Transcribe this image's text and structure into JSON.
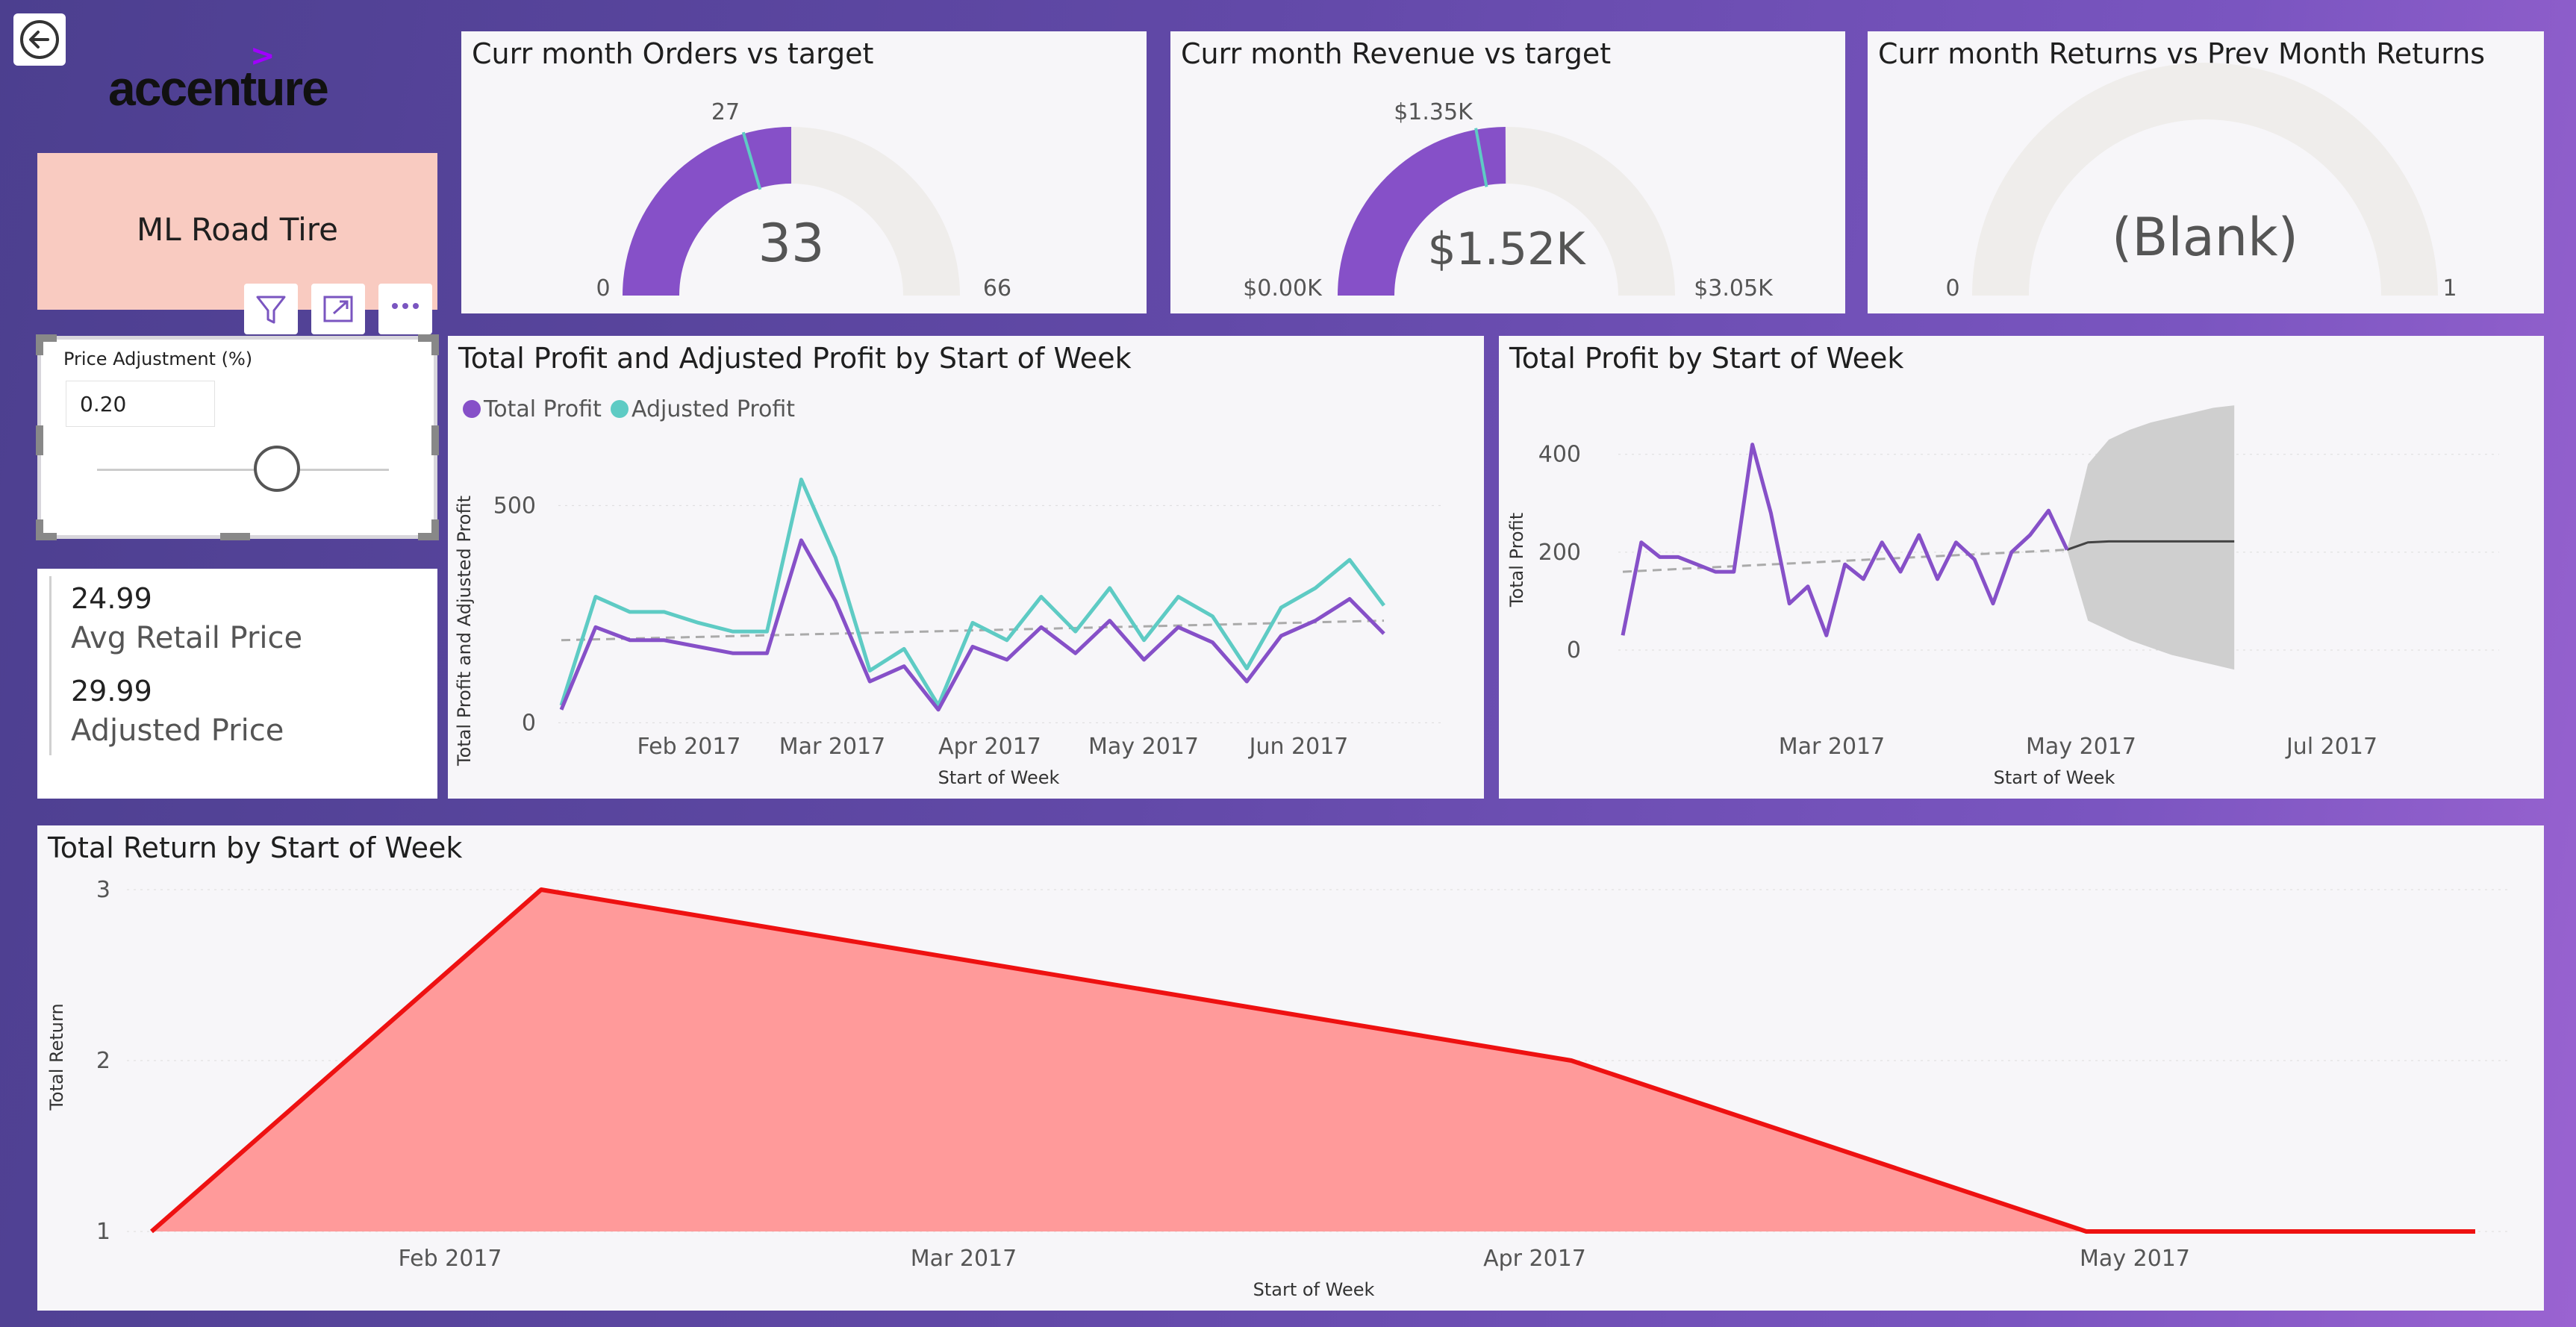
{
  "logo": {
    "text": "accenture",
    "mark": ">"
  },
  "product": {
    "name": "ML Road Tire"
  },
  "visual_header": {
    "icons": [
      "filter-icon",
      "focus-mode-icon",
      "more-options-icon"
    ]
  },
  "slicer": {
    "title": "Price Adjustment (%)",
    "value": "0.20",
    "level": 0.5
  },
  "kpis": [
    {
      "value": "24.99",
      "label": "Avg Retail Price"
    },
    {
      "value": "29.99",
      "label": "Adjusted Price"
    }
  ],
  "gauges": [
    {
      "title": "Curr month Orders vs target",
      "value_label": "33",
      "min_label": "0",
      "max_label": "66",
      "target_label": "27",
      "value": 33,
      "min": 0,
      "max": 66,
      "target": 27
    },
    {
      "title": "Curr month Revenue vs target",
      "value_label": "$1.52K",
      "min_label": "$0.00K",
      "max_label": "$3.05K",
      "target_label": "$1.35K",
      "value": 1.52,
      "min": 0,
      "max": 3.05,
      "target": 1.35
    },
    {
      "title": "Curr month Returns vs Prev Month Returns",
      "value_label": "(Blank)",
      "min_label": "0",
      "max_label": "1",
      "target_label": "",
      "value": null,
      "min": 0,
      "max": 1,
      "target": null
    }
  ],
  "colors": {
    "purple": "#8650c8",
    "teal": "#5ecbc4",
    "track": "#efedeb",
    "area_fill": "#ff9a9a",
    "area_line": "#ee1111",
    "forecast": "#cfcfcf"
  },
  "chart_data": [
    {
      "type": "line",
      "title": "Total Profit and Adjusted Profit by Start of Week",
      "xlabel": "Start of Week",
      "ylabel": "Total Profit and Adjusted Profit",
      "x_ticks": [
        "Feb 2017",
        "Mar 2017",
        "Apr 2017",
        "May 2017",
        "Jun 2017"
      ],
      "y_ticks": [
        "0",
        "500"
      ],
      "ylim": [
        -20,
        650
      ],
      "legend": "top-left",
      "grid": true,
      "trendline": true,
      "series": [
        {
          "name": "Total Profit",
          "values": [
            30,
            220,
            190,
            190,
            175,
            160,
            160,
            420,
            280,
            95,
            130,
            30,
            175,
            145,
            220,
            160,
            235,
            145,
            220,
            185,
            95,
            200,
            235,
            285,
            205
          ]
        },
        {
          "name": "Adjusted Profit",
          "values": [
            40,
            290,
            255,
            255,
            230,
            210,
            210,
            560,
            380,
            120,
            170,
            40,
            230,
            190,
            290,
            210,
            310,
            190,
            290,
            245,
            125,
            265,
            310,
            375,
            270
          ]
        }
      ]
    },
    {
      "type": "line",
      "title": "Total Profit by Start of Week",
      "xlabel": "Start of Week",
      "ylabel": "Total Profit",
      "x_ticks": [
        "Mar 2017",
        "May 2017",
        "Jul 2017"
      ],
      "y_ticks": [
        "0",
        "200",
        "400"
      ],
      "ylim": [
        -90,
        520
      ],
      "grid": true,
      "trendline": true,
      "series": [
        {
          "name": "Total Profit",
          "values": [
            30,
            220,
            190,
            190,
            175,
            160,
            160,
            420,
            280,
            95,
            130,
            30,
            175,
            145,
            220,
            160,
            235,
            145,
            220,
            185,
            95,
            200,
            235,
            285,
            205
          ]
        }
      ],
      "forecast": {
        "values": [
          220,
          222,
          222,
          222,
          222,
          222,
          222,
          222
        ],
        "upper": [
          380,
          430,
          450,
          465,
          475,
          485,
          495,
          500
        ],
        "lower": [
          60,
          40,
          20,
          5,
          -10,
          -20,
          -30,
          -40
        ]
      }
    },
    {
      "type": "area",
      "title": "Total Return by Start of Week",
      "xlabel": "Start of Week",
      "ylabel": "Total Return",
      "x_ticks": [
        "Feb 2017",
        "Mar 2017",
        "Apr 2017",
        "May 2017"
      ],
      "y_ticks": [
        "1",
        "2",
        "3"
      ],
      "ylim": [
        1,
        3
      ],
      "grid": true,
      "series": [
        {
          "name": "Total Return",
          "values": [
            1,
            3,
            2,
            1,
            1
          ]
        }
      ]
    }
  ]
}
